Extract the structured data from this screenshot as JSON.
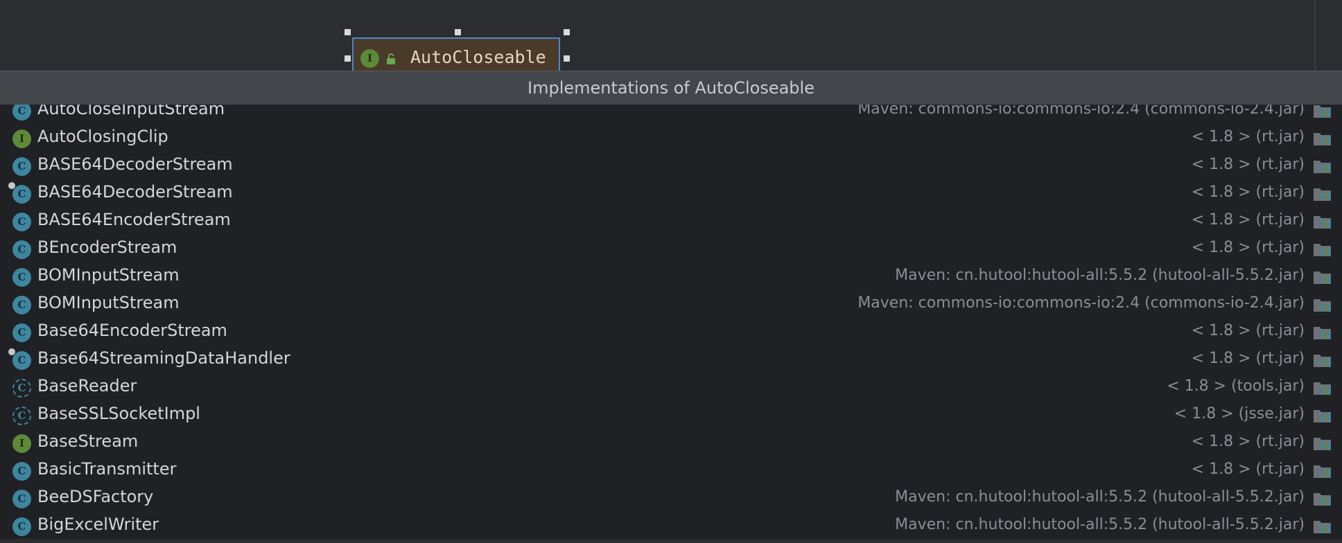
{
  "diagram": {
    "node": {
      "label": "AutoCloseable",
      "icon": "interface-icon",
      "icon_glyph": "I"
    }
  },
  "popup": {
    "title": "Implementations of AutoCloseable",
    "items": [
      {
        "name": "AutoCloseInputStream",
        "kind": "class",
        "location": "Maven: commons-io:commons-io:2.4 (commons-io-2.4.jar)"
      },
      {
        "name": "AutoClosingClip",
        "kind": "interface",
        "location": "< 1.8 > (rt.jar)"
      },
      {
        "name": "BASE64DecoderStream",
        "kind": "class",
        "location": "< 1.8 > (rt.jar)"
      },
      {
        "name": "BASE64DecoderStream",
        "kind": "class-pinned",
        "location": "< 1.8 > (rt.jar)"
      },
      {
        "name": "BASE64EncoderStream",
        "kind": "class",
        "location": "< 1.8 > (rt.jar)"
      },
      {
        "name": "BEncoderStream",
        "kind": "class",
        "location": "< 1.8 > (rt.jar)"
      },
      {
        "name": "BOMInputStream",
        "kind": "class",
        "location": "Maven: cn.hutool:hutool-all:5.5.2 (hutool-all-5.5.2.jar)"
      },
      {
        "name": "BOMInputStream",
        "kind": "class",
        "location": "Maven: commons-io:commons-io:2.4 (commons-io-2.4.jar)"
      },
      {
        "name": "Base64EncoderStream",
        "kind": "class",
        "location": "< 1.8 > (rt.jar)"
      },
      {
        "name": "Base64StreamingDataHandler",
        "kind": "class-pinned",
        "location": "< 1.8 > (rt.jar)"
      },
      {
        "name": "BaseReader",
        "kind": "abstract",
        "location": "< 1.8 > (tools.jar)"
      },
      {
        "name": "BaseSSLSocketImpl",
        "kind": "abstract",
        "location": "< 1.8 > (jsse.jar)"
      },
      {
        "name": "BaseStream",
        "kind": "interface",
        "location": "< 1.8 > (rt.jar)"
      },
      {
        "name": "BasicTransmitter",
        "kind": "class",
        "location": "< 1.8 > (rt.jar)"
      },
      {
        "name": "BeeDSFactory",
        "kind": "class",
        "location": "Maven: cn.hutool:hutool-all:5.5.2 (hutool-all-5.5.2.jar)"
      },
      {
        "name": "BigExcelWriter",
        "kind": "class",
        "location": "Maven: cn.hutool:hutool-all:5.5.2 (hutool-all-5.5.2.jar)"
      }
    ]
  },
  "colors": {
    "background": "#2b2d30",
    "popup_bg": "#1f2124",
    "header_bg": "#43464b",
    "class_icon": "#3e86a0",
    "interface_icon": "#5d8a37",
    "selection_border": "#4a88c7"
  },
  "icons": {
    "class": "class-icon",
    "interface": "interface-icon",
    "abstract": "abstract-class-icon",
    "library": "library-icon"
  }
}
